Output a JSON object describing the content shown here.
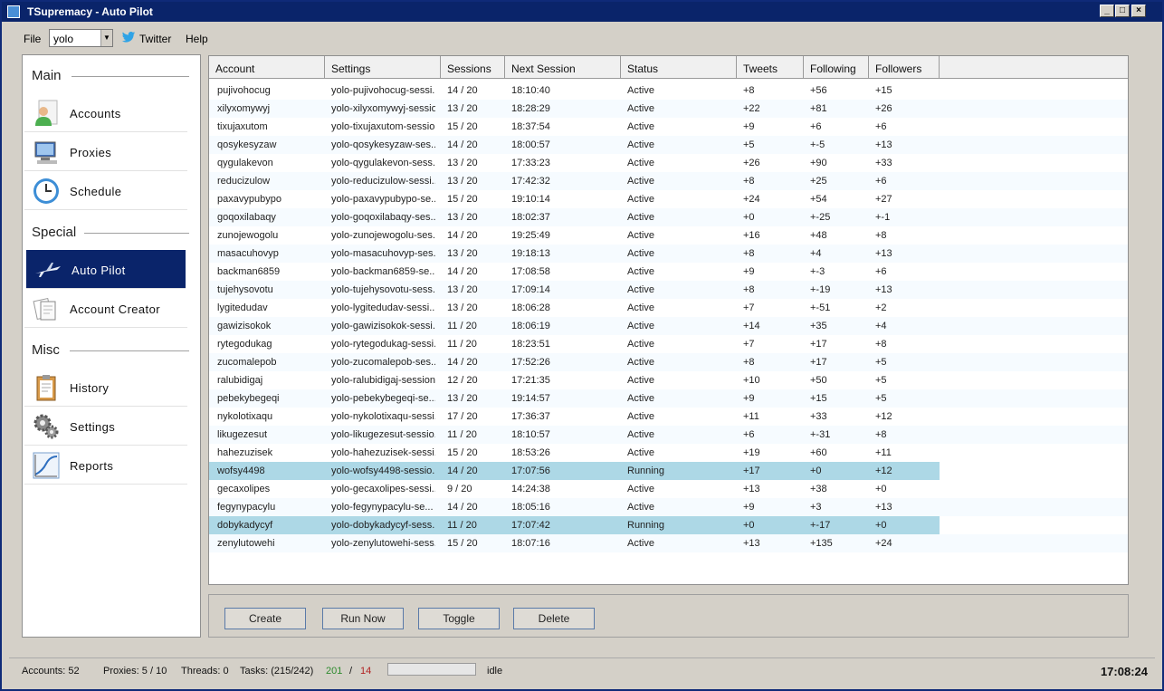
{
  "window": {
    "title": "TSupremacy - Auto Pilot"
  },
  "menu": {
    "file": "File",
    "account_combo": "yolo",
    "twitter": "Twitter",
    "help": "Help"
  },
  "sidebar": {
    "sections": [
      {
        "label": "Main"
      },
      {
        "label": "Special"
      },
      {
        "label": "Misc"
      }
    ],
    "items": [
      {
        "label": "Accounts",
        "icon": "user-icon"
      },
      {
        "label": "Proxies",
        "icon": "computer-icon"
      },
      {
        "label": "Schedule",
        "icon": "clock-icon"
      },
      {
        "label": "Auto Pilot",
        "icon": "airplane-icon",
        "active": true
      },
      {
        "label": "Account Creator",
        "icon": "documents-icon"
      },
      {
        "label": "History",
        "icon": "clipboard-icon"
      },
      {
        "label": "Settings",
        "icon": "gears-icon"
      },
      {
        "label": "Reports",
        "icon": "chart-icon"
      }
    ]
  },
  "grid": {
    "columns": [
      "Account",
      "Settings",
      "Sessions",
      "Next Session",
      "Status",
      "Tweets",
      "Following",
      "Followers"
    ],
    "rows": [
      [
        "pujivohocug",
        "yolo-pujivohocug-sessi...",
        "14 / 20",
        "18:10:40",
        "Active",
        "+8",
        "+56",
        "+15"
      ],
      [
        "xilyxomywyj",
        "yolo-xilyxomywyj-sessio...",
        "13 / 20",
        "18:28:29",
        "Active",
        "+22",
        "+81",
        "+26"
      ],
      [
        "tixujaxutom",
        "yolo-tixujaxutom-sessio...",
        "15 / 20",
        "18:37:54",
        "Active",
        "+9",
        "+6",
        "+6"
      ],
      [
        "qosykesyzaw",
        "yolo-qosykesyzaw-ses...",
        "14 / 20",
        "18:00:57",
        "Active",
        "+5",
        "+-5",
        "+13"
      ],
      [
        "qygulakevon",
        "yolo-qygulakevon-sess...",
        "13 / 20",
        "17:33:23",
        "Active",
        "+26",
        "+90",
        "+33"
      ],
      [
        "reducizulow",
        "yolo-reducizulow-sessi...",
        "13 / 20",
        "17:42:32",
        "Active",
        "+8",
        "+25",
        "+6"
      ],
      [
        "paxavypubypo",
        "yolo-paxavypubypo-se...",
        "15 / 20",
        "19:10:14",
        "Active",
        "+24",
        "+54",
        "+27"
      ],
      [
        "goqoxilabaqy",
        "yolo-goqoxilabaqy-ses...",
        "13 / 20",
        "18:02:37",
        "Active",
        "+0",
        "+-25",
        "+-1"
      ],
      [
        "zunojewogolu",
        "yolo-zunojewogolu-ses...",
        "14 / 20",
        "19:25:49",
        "Active",
        "+16",
        "+48",
        "+8"
      ],
      [
        "masacuhovyp",
        "yolo-masacuhovyp-ses...",
        "13 / 20",
        "19:18:13",
        "Active",
        "+8",
        "+4",
        "+13"
      ],
      [
        "backman6859",
        "yolo-backman6859-se...",
        "14 / 20",
        "17:08:58",
        "Active",
        "+9",
        "+-3",
        "+6"
      ],
      [
        "tujehysovotu",
        "yolo-tujehysovotu-sess...",
        "13 / 20",
        "17:09:14",
        "Active",
        "+8",
        "+-19",
        "+13"
      ],
      [
        "lygitedudav",
        "yolo-lygitedudav-sessi...",
        "13 / 20",
        "18:06:28",
        "Active",
        "+7",
        "+-51",
        "+2"
      ],
      [
        "gawizisokok",
        "yolo-gawizisokok-sessi...",
        "11 / 20",
        "18:06:19",
        "Active",
        "+14",
        "+35",
        "+4"
      ],
      [
        "rytegodukag",
        "yolo-rytegodukag-sessi...",
        "11 / 20",
        "18:23:51",
        "Active",
        "+7",
        "+17",
        "+8"
      ],
      [
        "zucomalepob",
        "yolo-zucomalepob-ses...",
        "14 / 20",
        "17:52:26",
        "Active",
        "+8",
        "+17",
        "+5"
      ],
      [
        "ralubidigaj",
        "yolo-ralubidigaj-session...",
        "12 / 20",
        "17:21:35",
        "Active",
        "+10",
        "+50",
        "+5"
      ],
      [
        "pebekybegeqi",
        "yolo-pebekybegeqi-se...",
        "13 / 20",
        "19:14:57",
        "Active",
        "+9",
        "+15",
        "+5"
      ],
      [
        "nykolotixaqu",
        "yolo-nykolotixaqu-sessi...",
        "17 / 20",
        "17:36:37",
        "Active",
        "+11",
        "+33",
        "+12"
      ],
      [
        "likugezesut",
        "yolo-likugezesut-sessio...",
        "11 / 20",
        "18:10:57",
        "Active",
        "+6",
        "+-31",
        "+8"
      ],
      [
        "hahezuzisek",
        "yolo-hahezuzisek-sessi...",
        "15 / 20",
        "18:53:26",
        "Active",
        "+19",
        "+60",
        "+11"
      ],
      [
        "wofsy4498",
        "yolo-wofsy4498-sessio...",
        "14 / 20",
        "17:07:56",
        "Running",
        "+17",
        "+0",
        "+12"
      ],
      [
        "gecaxolipes",
        "yolo-gecaxolipes-sessi...",
        "9 / 20",
        "14:24:38",
        "Active",
        "+13",
        "+38",
        "+0"
      ],
      [
        "fegynypacylu",
        "yolo-fegynypacylu-se...",
        "14 / 20",
        "18:05:16",
        "Active",
        "+9",
        "+3",
        "+13"
      ],
      [
        "dobykadycyf",
        "yolo-dobykadycyf-sess...",
        "11 / 20",
        "17:07:42",
        "Running",
        "+0",
        "+-17",
        "+0"
      ],
      [
        "zenylutowehi",
        "yolo-zenylutowehi-sess...",
        "15 / 20",
        "18:07:16",
        "Active",
        "+13",
        "+135",
        "+24"
      ]
    ]
  },
  "buttons": {
    "create": "Create",
    "run_now": "Run Now",
    "toggle": "Toggle",
    "delete": "Delete"
  },
  "status": {
    "accounts": "Accounts: 52",
    "proxies": "Proxies: 5 / 10",
    "threads": "Threads: 0",
    "tasks": "Tasks: (215/242)",
    "done": "201",
    "sep": "/",
    "failed": "14",
    "progress": 0,
    "state": "idle",
    "clock": "17:08:24"
  },
  "colors": {
    "active_nav": "#0a246a",
    "running_row": "#add8e6",
    "done_count": "#2e8b2e",
    "failed_count": "#b22222"
  }
}
